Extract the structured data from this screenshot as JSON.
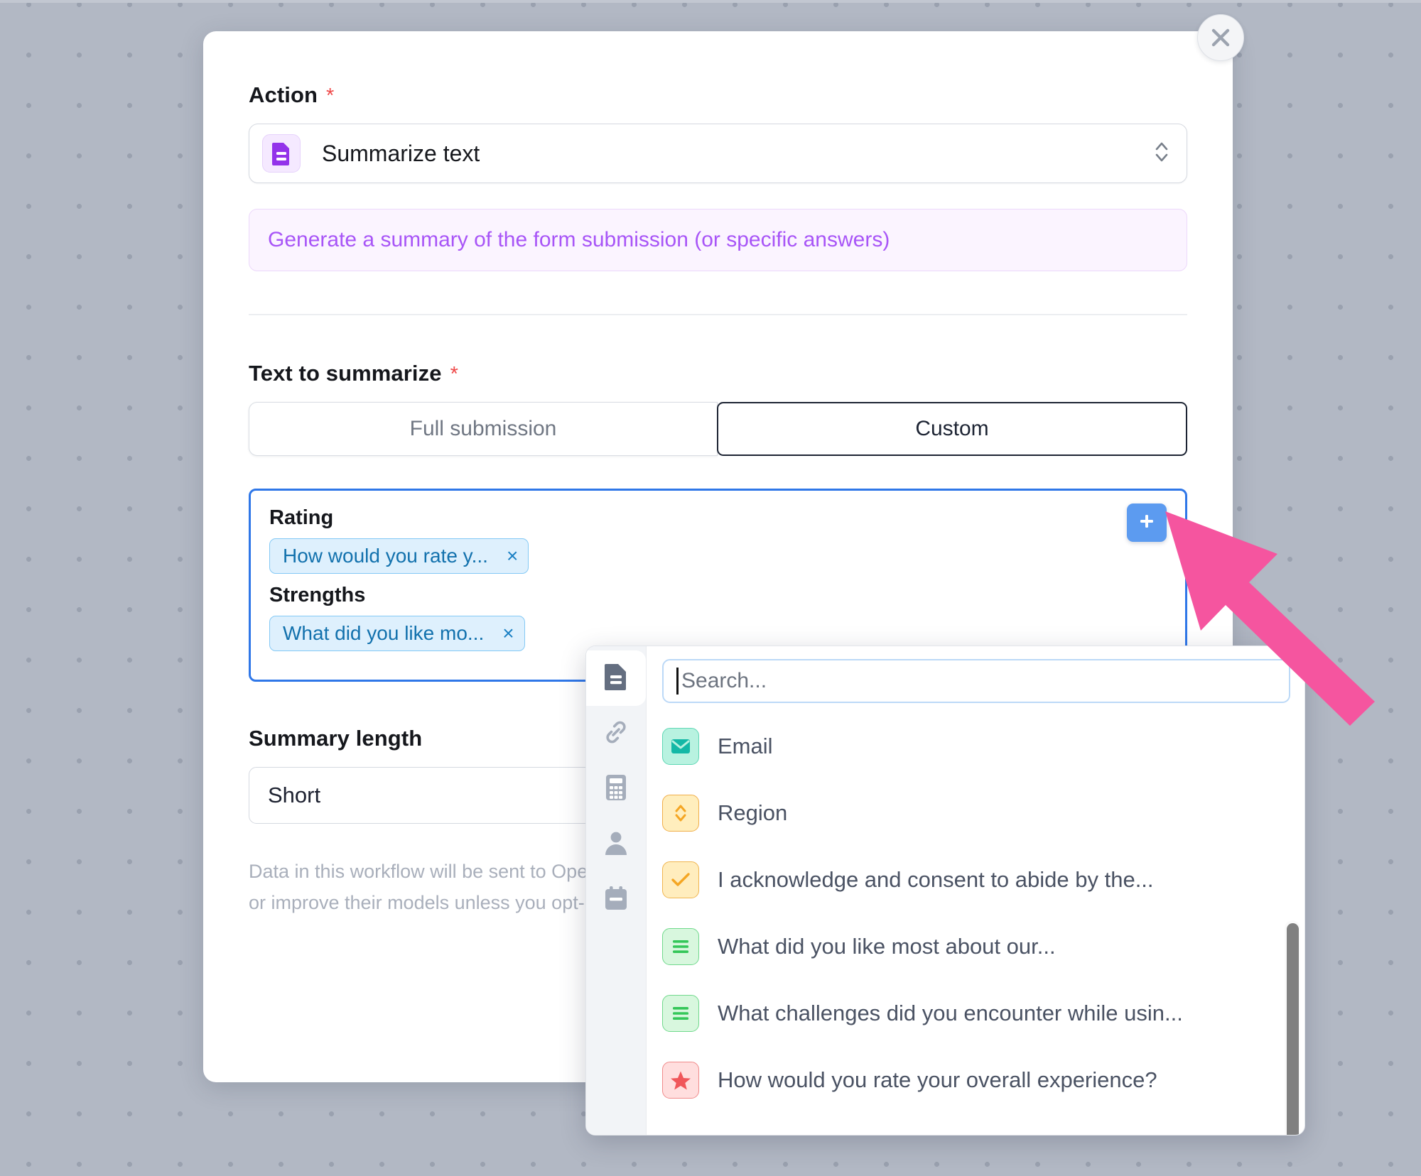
{
  "colors": {
    "accent_purple": "#a855f7",
    "tag_blue": "#1271ad",
    "plus_blue": "#5c9bf0",
    "focus_border": "#2f77e8",
    "required_red": "#ef4a4a",
    "background": "#b2b8c4"
  },
  "modal": {
    "close_icon": "close-icon",
    "action": {
      "label": "Action",
      "required_mark": "*",
      "icon": "document-summary-icon",
      "value": "Summarize text",
      "chevron_icon": "chevron-up-down-icon",
      "description": "Generate a summary of the form submission (or specific answers)"
    },
    "text_to_summarize": {
      "label": "Text to summarize",
      "required_mark": "*",
      "options": [
        {
          "label": "Full submission",
          "selected": false
        },
        {
          "label": "Custom",
          "selected": true
        }
      ],
      "add_button_icon": "plus-icon",
      "groups": [
        {
          "group_label": "Rating",
          "chips": [
            {
              "text": "How would you rate y...",
              "remove_icon": "close-x-icon",
              "remove_label": "×"
            }
          ]
        },
        {
          "group_label": "Strengths",
          "chips": [
            {
              "text": "What did you like mo...",
              "remove_icon": "close-x-icon",
              "remove_label": "×"
            }
          ]
        }
      ]
    },
    "summary_length": {
      "label": "Summary length",
      "value": "Short"
    },
    "disclaimer": "Data in this workflow will be sent to OpenAI. OpenAI will not use the submitted data to train or improve their models unless you opt-in for that purpose. More details."
  },
  "dropdown": {
    "rail": [
      {
        "icon": "document-icon",
        "active": true
      },
      {
        "icon": "link-icon",
        "active": false
      },
      {
        "icon": "calculator-icon",
        "active": false
      },
      {
        "icon": "person-icon",
        "active": false
      },
      {
        "icon": "calendar-icon",
        "active": false
      }
    ],
    "search": {
      "placeholder": "Search...",
      "value": ""
    },
    "items": [
      {
        "label": "Email",
        "icon": "email-icon",
        "icon_class": "ico-email"
      },
      {
        "label": "Region",
        "icon": "select-updown-icon",
        "icon_class": "ico-region"
      },
      {
        "label": "I acknowledge and consent to abide by the...",
        "icon": "checkbox-check-icon",
        "icon_class": "ico-check"
      },
      {
        "label": "What did you like most about our...",
        "icon": "long-text-icon",
        "icon_class": "ico-text"
      },
      {
        "label": "What challenges did you encounter while usin...",
        "icon": "long-text-icon",
        "icon_class": "ico-text"
      },
      {
        "label": "How would you rate your overall experience?",
        "icon": "star-rating-icon",
        "icon_class": "ico-star"
      }
    ],
    "scrollbar_icon": "vertical-scrollbar"
  },
  "annotation": {
    "arrow_icon": "pointer-arrow",
    "arrow_color": "#f5559f"
  }
}
